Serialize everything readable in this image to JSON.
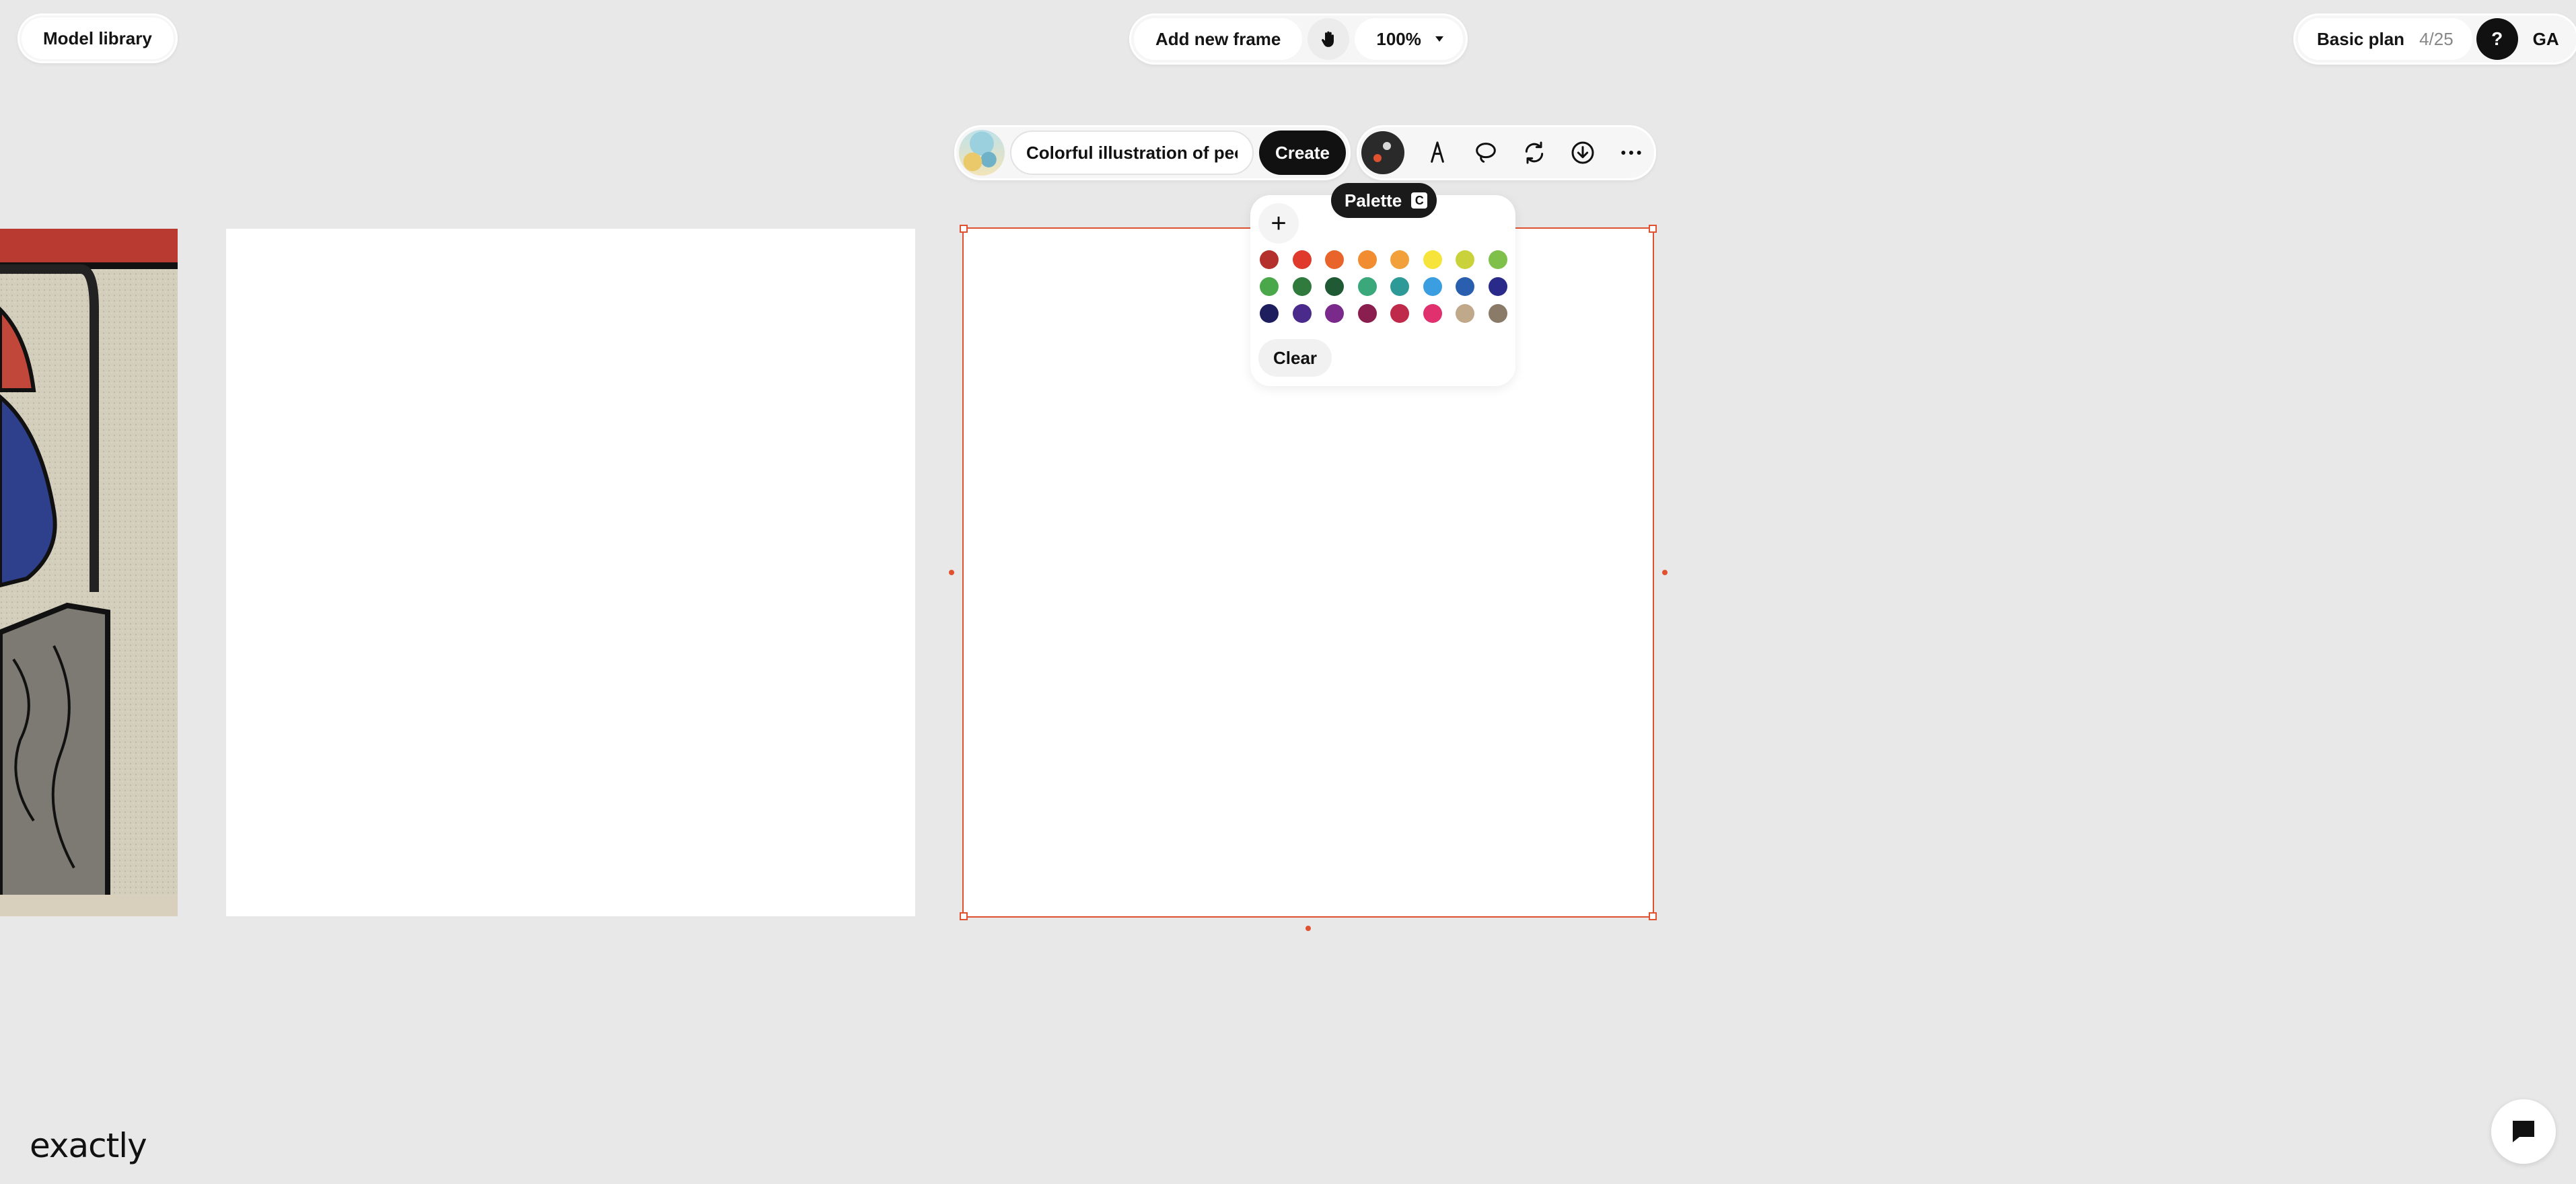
{
  "top_left": {
    "model_library_label": "Model library"
  },
  "top_center": {
    "add_frame_label": "Add new frame",
    "zoom_label": "100%"
  },
  "top_right": {
    "plan_label": "Basic plan",
    "credits": "4/25",
    "help_label": "?",
    "avatar_initials": "GA"
  },
  "frame_toolbar": {
    "prompt_value": "Colorful illustration of people",
    "create_label": "Create"
  },
  "tooltip": {
    "label": "Palette",
    "shortcut": "C"
  },
  "palette": {
    "add_label": "+",
    "clear_label": "Clear",
    "colors": [
      "#b3302c",
      "#e03a2c",
      "#e8642a",
      "#f28c30",
      "#f2a03a",
      "#f6e43a",
      "#c9d23a",
      "#7ec04a",
      "#4aa84a",
      "#2f7a3c",
      "#1f5a35",
      "#3aa87a",
      "#2e9a98",
      "#3a9ee0",
      "#2a5fb0",
      "#2a2a8a",
      "#1e1e5e",
      "#4a2a8a",
      "#7a2a8a",
      "#8a1e4e",
      "#c02a4a",
      "#e0306e",
      "#c0a88a",
      "#8a7a68"
    ]
  },
  "brand": {
    "logo_text": "exactly",
    "accent_color": "#e0512f"
  }
}
